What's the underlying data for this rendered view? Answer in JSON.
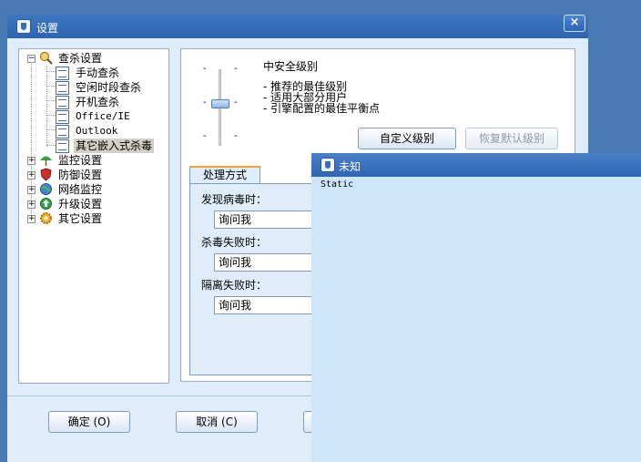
{
  "main_window": {
    "title": "设置",
    "close_glyph": "×"
  },
  "tree": {
    "items": [
      {
        "label": "查杀设置",
        "expander": "−",
        "icon": "magnifier-icon"
      },
      {
        "label": "手动查杀",
        "icon": "doc-icon"
      },
      {
        "label": "空闲时段查杀",
        "icon": "doc-icon"
      },
      {
        "label": "开机查杀",
        "icon": "doc-icon"
      },
      {
        "label": "Office/IE",
        "icon": "doc-icon"
      },
      {
        "label": "Outlook",
        "icon": "doc-icon"
      },
      {
        "label": "其它嵌入式杀毒",
        "icon": "doc-icon",
        "selected": true
      },
      {
        "label": "监控设置",
        "expander": "+",
        "icon": "umbrella-icon"
      },
      {
        "label": "防御设置",
        "expander": "+",
        "icon": "shield-icon"
      },
      {
        "label": "网络监控",
        "expander": "+",
        "icon": "globe-icon"
      },
      {
        "label": "升级设置",
        "expander": "+",
        "icon": "update-icon"
      },
      {
        "label": "其它设置",
        "expander": "+",
        "icon": "gear-icon"
      }
    ]
  },
  "security_level": {
    "slider_tick": "-",
    "title": "中安全级别",
    "lines": [
      "- 推荐的最佳级别",
      "- 适用大部分用户",
      "- 引擎配置的最佳平衡点"
    ],
    "custom_button": "自定义级别",
    "default_button": "恢复默认级别"
  },
  "handling": {
    "tab_label": "处理方式",
    "found_label": "发现病毒时：",
    "found_value": "询问我",
    "fail_label": "杀毒失败时：",
    "fail_value": "询问我",
    "quarantine_label": "隔离失败时：",
    "quarantine_value": "询问我"
  },
  "bottom": {
    "ok_button": "确定 (O)",
    "cancel_button": "取消 (C)"
  },
  "unknown_window": {
    "title": "未知",
    "static_text": "Static"
  },
  "colors": {
    "desktop": "#4a7ab4",
    "titlebar": "#2f65b0",
    "client": "#dfedfb",
    "tab_accent": "#f7a233"
  }
}
